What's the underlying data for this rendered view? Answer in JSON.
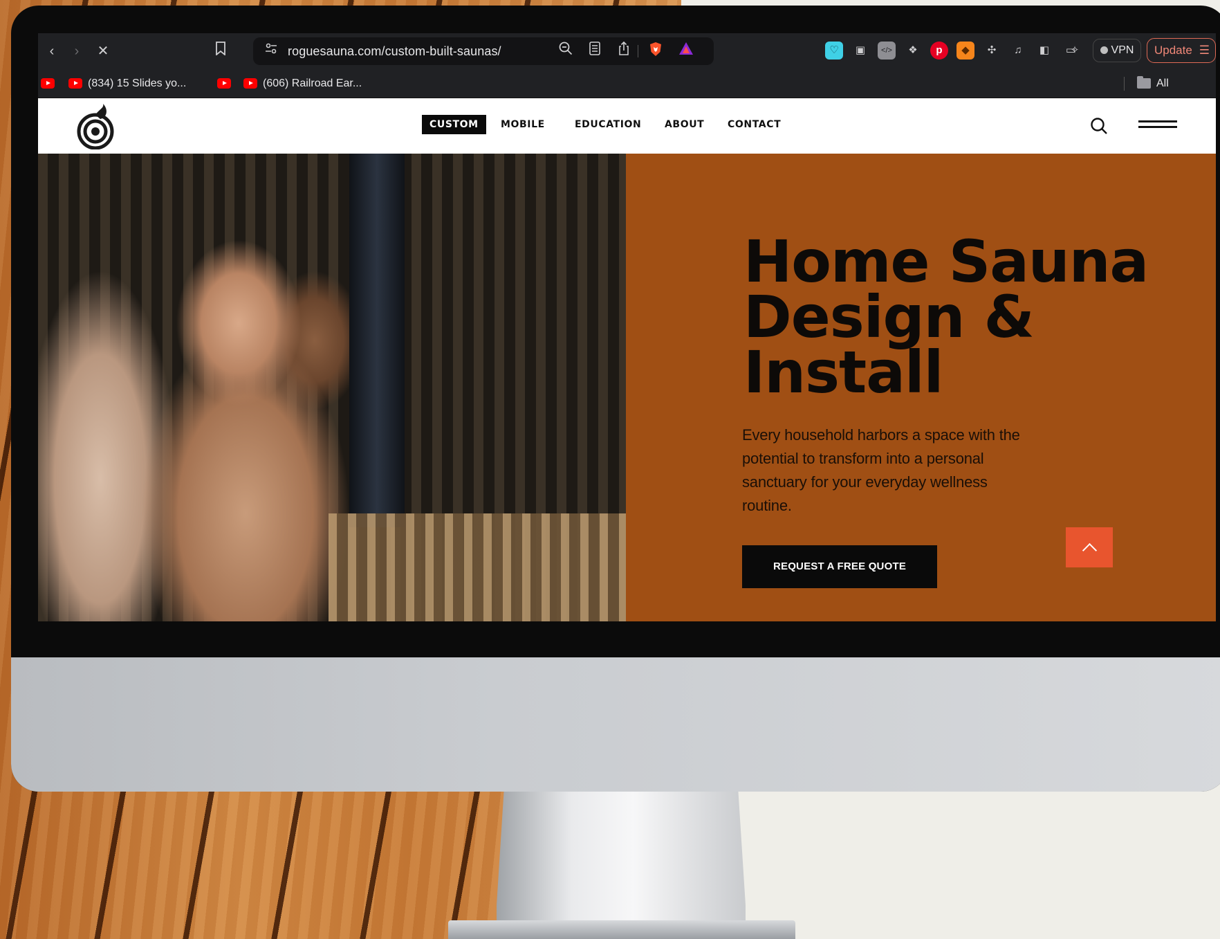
{
  "browser": {
    "url": "roguesauna.com/custom-built-saunas/",
    "vpn_label": "VPN",
    "update_label": "Update",
    "nav_icons": [
      "back-icon",
      "forward-icon",
      "stop-loading-icon"
    ],
    "bookmarks": [
      {
        "label": "",
        "icon": "youtube-icon"
      },
      {
        "label": "(834) 15 Slides yo...",
        "icon": "youtube-icon"
      },
      {
        "label": "",
        "icon": "youtube-icon"
      },
      {
        "label": "(606) Railroad Ear...",
        "icon": "youtube-icon"
      }
    ],
    "all_bookmarks_label": "All Bookmarks"
  },
  "site": {
    "nav": {
      "items": [
        {
          "label": "CUSTOM",
          "active": true
        },
        {
          "label": "MOBILE",
          "active": false
        },
        {
          "label": "EDUCATION",
          "active": false
        },
        {
          "label": "ABOUT",
          "active": false
        },
        {
          "label": "CONTACT",
          "active": false
        }
      ]
    },
    "hero": {
      "title_line1": "Home Sauna",
      "title_line2": "Design &",
      "title_line3": "Install",
      "copy": "Every household harbors a space with the potential to transform into a personal sanctuary for your everyday wellness routine.",
      "cta_label": "REQUEST A FREE QUOTE"
    }
  },
  "colors": {
    "hero_panel": "#a04f14",
    "cta_bg": "#0a0a0a",
    "back_to_top": "#e8552e",
    "active_nav_bg": "#0a0a0a"
  }
}
